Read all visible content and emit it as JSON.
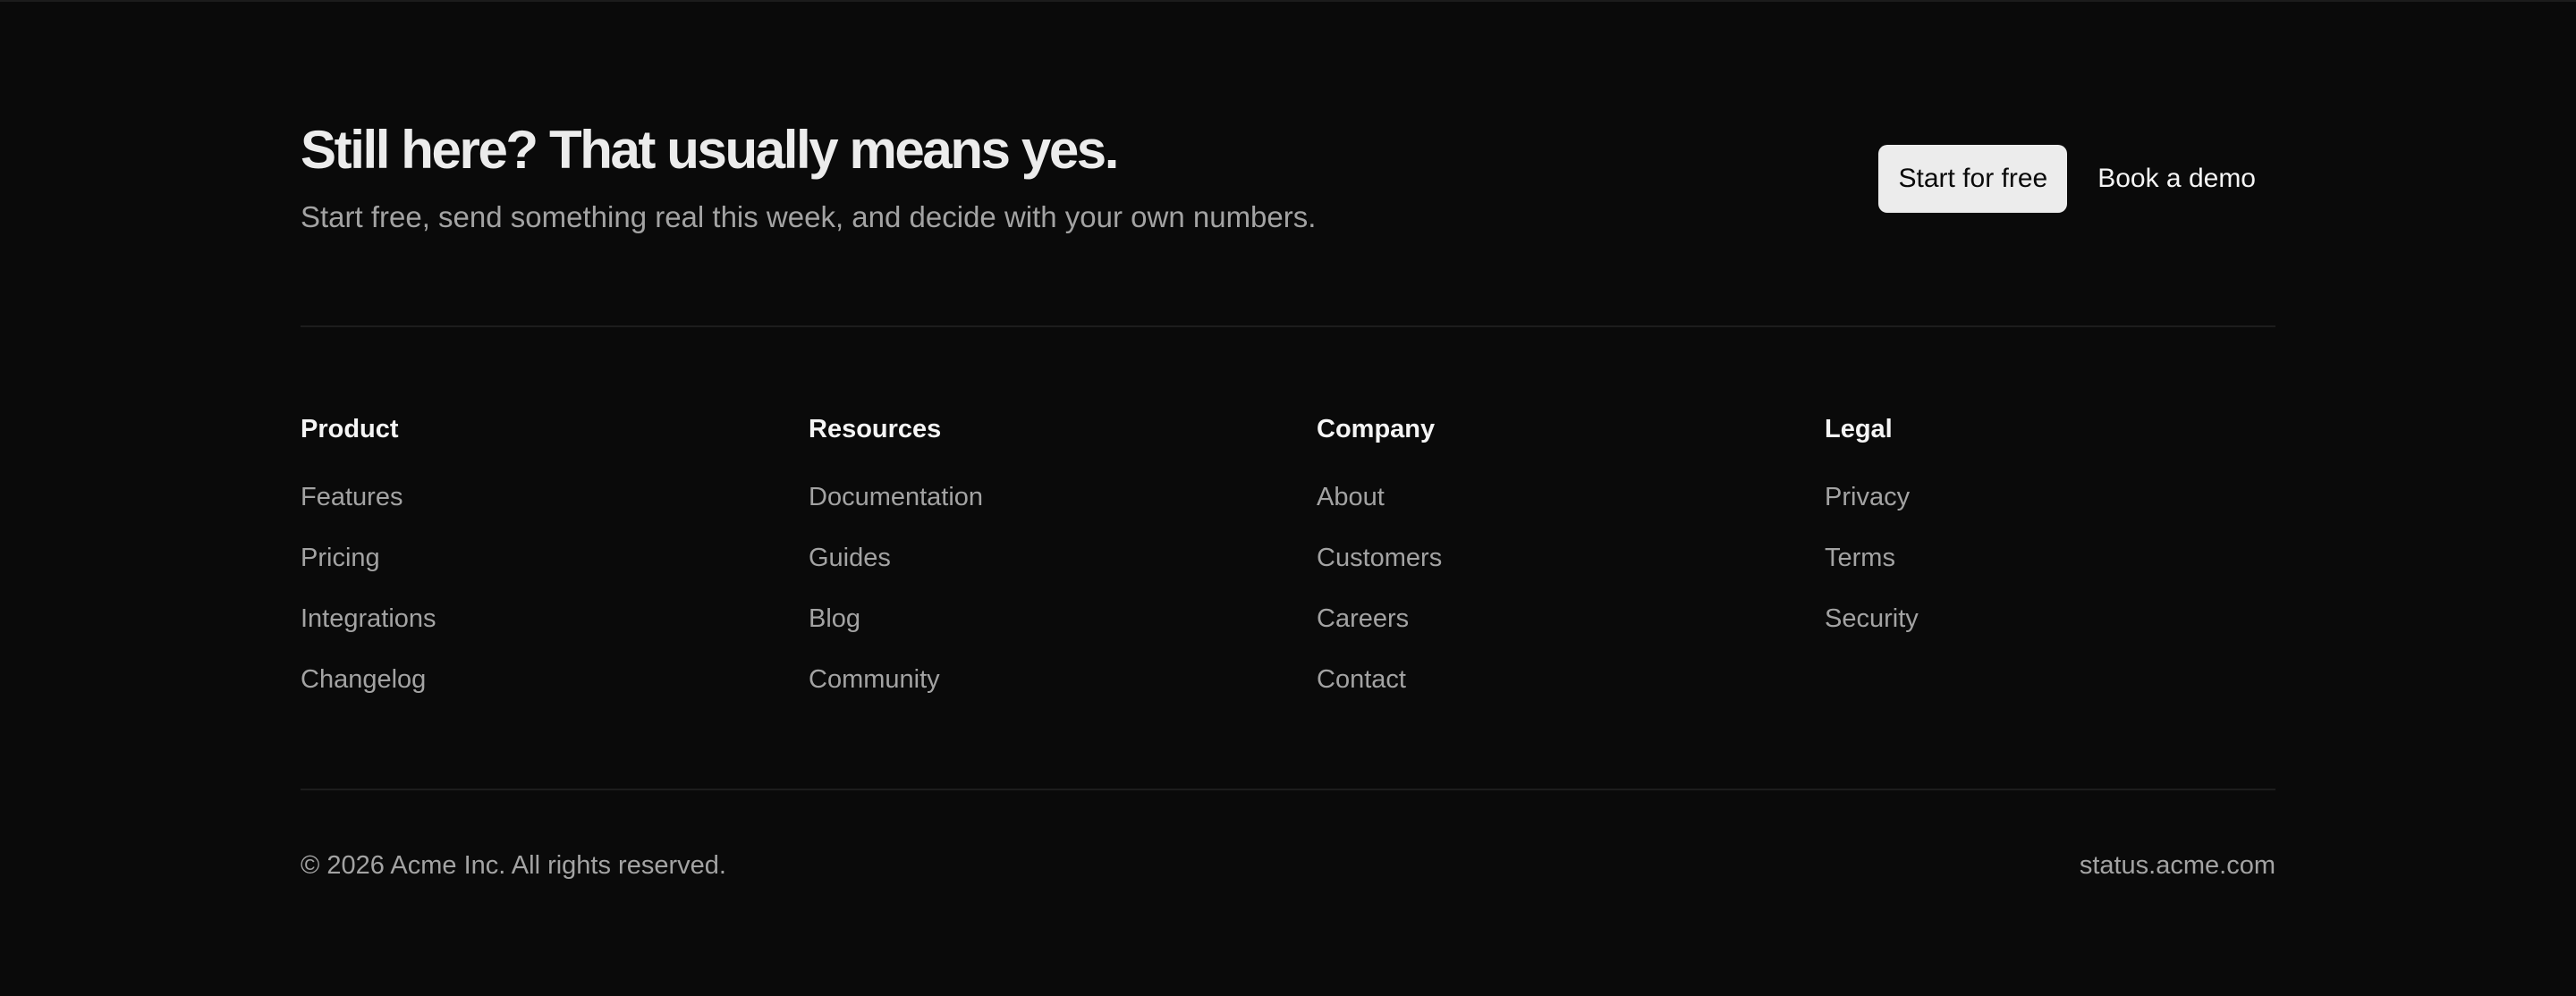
{
  "cta": {
    "title": "Still here? That usually means yes.",
    "subtitle": "Start free, send something real this week, and decide with your own numbers.",
    "primary_label": "Start for free",
    "secondary_label": "Book a demo"
  },
  "footer": {
    "columns": [
      {
        "heading": "Product",
        "links": [
          "Features",
          "Pricing",
          "Integrations",
          "Changelog"
        ]
      },
      {
        "heading": "Resources",
        "links": [
          "Documentation",
          "Guides",
          "Blog",
          "Community"
        ]
      },
      {
        "heading": "Company",
        "links": [
          "About",
          "Customers",
          "Careers",
          "Contact"
        ]
      },
      {
        "heading": "Legal",
        "links": [
          "Privacy",
          "Terms",
          "Security"
        ]
      }
    ],
    "copyright": "© 2026 Acme Inc. All rights reserved.",
    "status_link": "status.acme.com"
  },
  "colors": {
    "background": "#0a0a0a",
    "heading_text": "#ececec",
    "muted_text": "#a3a3a3",
    "primary_button_bg": "#ececec",
    "divider": "#1d1d1d"
  }
}
